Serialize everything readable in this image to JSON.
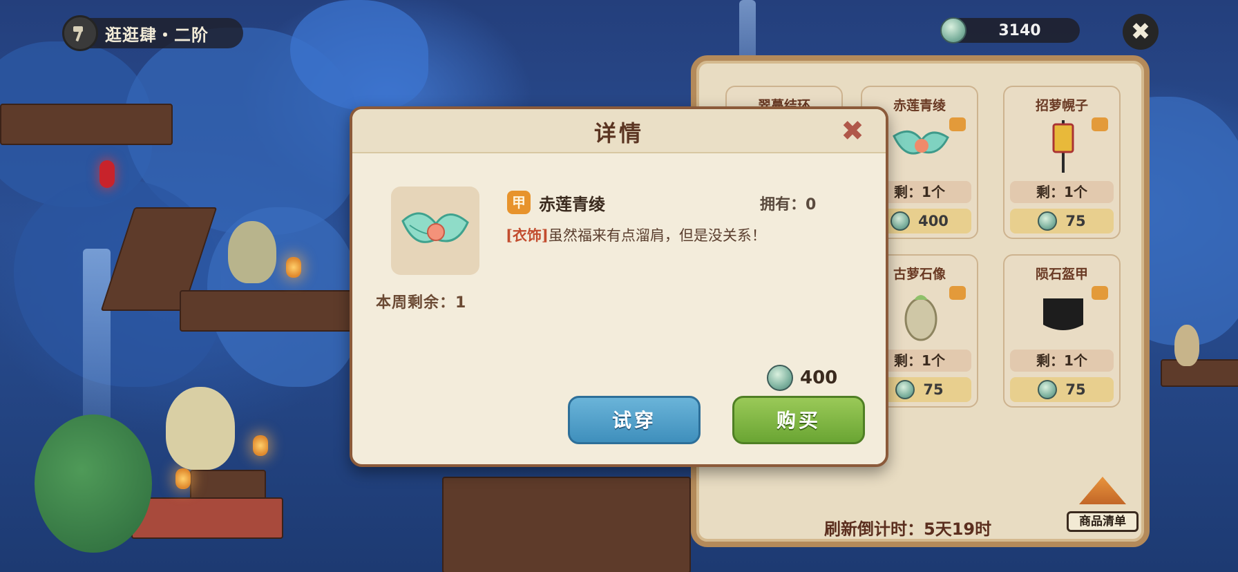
{
  "hud": {
    "level_label": "逛逛肆・二阶",
    "currency_amount": "3140",
    "icons": [
      "hammer-icon",
      "jade-coin-icon",
      "close-icon"
    ]
  },
  "modal": {
    "title": "详情",
    "item_type_badge": "甲",
    "item_name": "赤莲青绫",
    "owned_label": "拥有：0",
    "description_tag": "[衣饰]",
    "description_text": "虽然福来有点溜肩，但是没关系！",
    "weekly_remaining": "本周剩余：1",
    "price": "400",
    "try_on_label": "试穿",
    "buy_label": "购买"
  },
  "shop": {
    "items": [
      {
        "name": "翠蔓结环",
        "stock": "",
        "price": ""
      },
      {
        "name": "赤莲青绫",
        "stock": "剩：1个",
        "price": "400"
      },
      {
        "name": "招萝幌子",
        "stock": "剩：1个",
        "price": "75"
      },
      {
        "name": "古萝石像",
        "stock": "剩：1个",
        "price": "75"
      },
      {
        "name": "陨石盔甲",
        "stock": "剩：1个",
        "price": "75"
      }
    ],
    "refresh_countdown": "刷新倒计时：5天19时",
    "goods_list_label": "商品清单"
  },
  "colors": {
    "panel_bg": "#f3ecdb",
    "panel_border": "#8b5a3a",
    "try_button": "#4fa0cc",
    "buy_button": "#7db541",
    "tag_red": "#c24c2e",
    "badge_orange": "#e7932c"
  }
}
